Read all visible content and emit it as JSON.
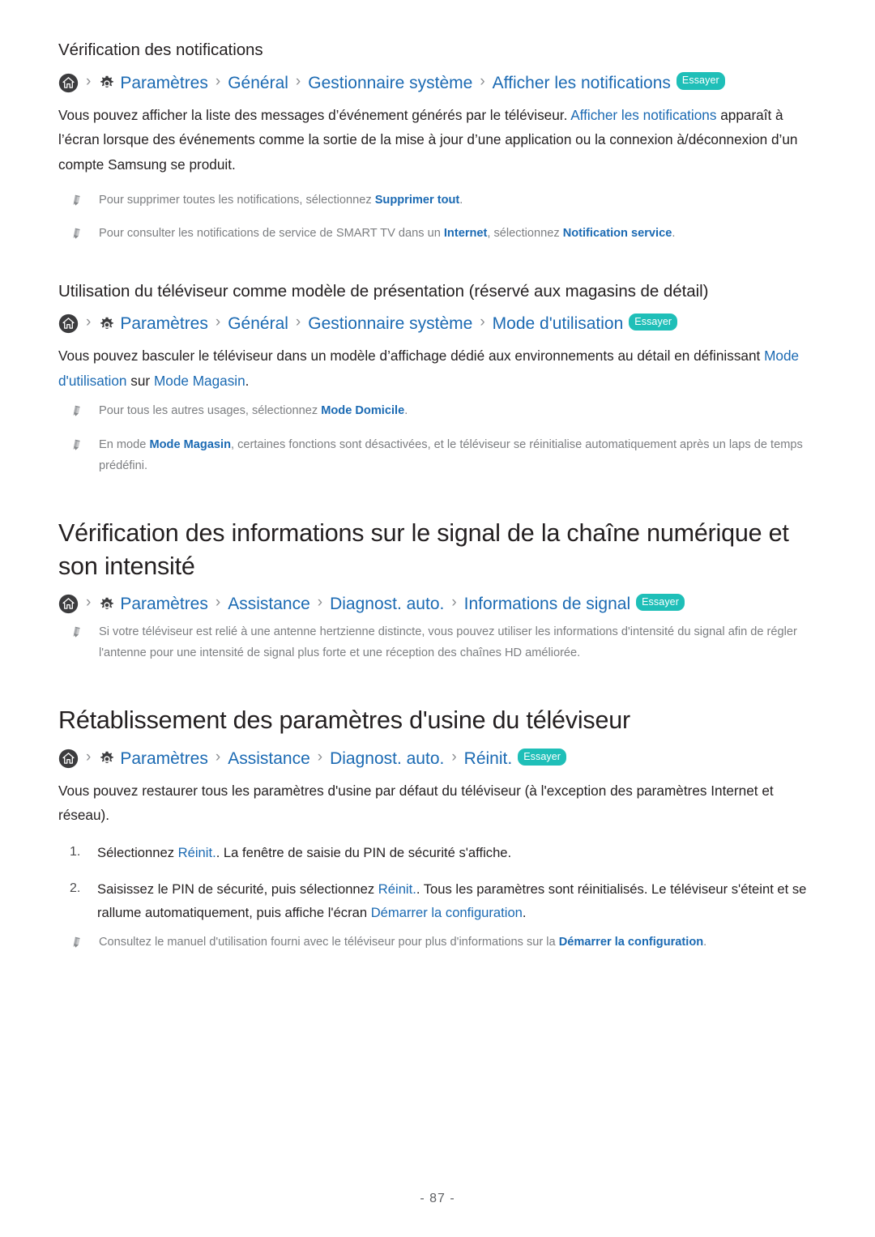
{
  "document": {
    "page_number": "- 87 -"
  },
  "sections": [
    {
      "heading": "Vérification des notifications",
      "breadcrumb": {
        "home_icon": "home-icon",
        "gear_icon": "gear-icon",
        "segments": [
          "Paramètres",
          "Général",
          "Gestionnaire système",
          "Afficher les notifications"
        ],
        "separator": "›",
        "badge": "Essayer"
      },
      "paragraph": {
        "part1": "Vous pouvez afficher la liste des messages d’événement générés par le téléviseur. ",
        "link1": "Afficher les notifications",
        "part2": " apparaît à l’écran lorsque des événements comme la sortie de la mise à jour d’une application ou la connexion à/déconnexion d’un compte Samsung se produit."
      },
      "notes": [
        {
          "icon": "pencil-icon",
          "part1": "Pour supprimer toutes les notifications, sélectionnez ",
          "link1": "Supprimer tout",
          "part2": "."
        },
        {
          "icon": "pencil-icon",
          "part1": "Pour consulter les notifications de service de SMART TV dans un ",
          "link1": "Internet",
          "part2": ", sélectionnez ",
          "link2": "Notification service",
          "part3": "."
        }
      ]
    },
    {
      "heading": "Utilisation du téléviseur comme modèle de présentation (réservé aux magasins de détail)",
      "breadcrumb": {
        "home_icon": "home-icon",
        "gear_icon": "gear-icon",
        "segments": [
          "Paramètres",
          "Général",
          "Gestionnaire système",
          "Mode d'utilisation"
        ],
        "separator": "›",
        "badge": "Essayer"
      },
      "paragraph": {
        "part1": "Vous pouvez basculer le téléviseur dans un modèle d’affichage dédié aux environnements au détail en définissant ",
        "link1": "Mode d'utilisation",
        "part2": " sur ",
        "link2": "Mode Magasin",
        "part3": "."
      },
      "notes": [
        {
          "icon": "pencil-icon",
          "part1": "Pour tous les autres usages, sélectionnez ",
          "link1": "Mode Domicile",
          "part2": "."
        },
        {
          "icon": "pencil-icon",
          "part1": "En mode ",
          "link1": "Mode Magasin",
          "part2": ", certaines fonctions sont désactivées, et le téléviseur se réinitialise automatiquement après un laps de temps prédéfini."
        }
      ]
    }
  ],
  "chapters": [
    {
      "heading": "Vérification des informations sur le signal de la chaîne numérique et son intensité",
      "breadcrumb": {
        "home_icon": "home-icon",
        "gear_icon": "gear-icon",
        "segments": [
          "Paramètres",
          "Assistance",
          "Diagnost. auto.",
          "Informations de signal"
        ],
        "separator": "›",
        "badge": "Essayer"
      },
      "notes": [
        {
          "icon": "pencil-icon",
          "text": "Si votre téléviseur est relié à une antenne hertzienne distincte, vous pouvez utiliser les informations d'intensité du signal afin de régler l'antenne pour une intensité de signal plus forte et une réception des chaînes HD améliorée."
        }
      ]
    },
    {
      "heading": "Rétablissement des paramètres d'usine du téléviseur",
      "breadcrumb": {
        "home_icon": "home-icon",
        "gear_icon": "gear-icon",
        "segments": [
          "Paramètres",
          "Assistance",
          "Diagnost. auto.",
          "Réinit."
        ],
        "separator": "›",
        "badge": "Essayer"
      },
      "paragraph": {
        "part1": "Vous pouvez restaurer tous les paramètres d'usine par défaut du téléviseur (à l'exception des paramètres Internet et réseau)."
      },
      "steps": [
        {
          "num": "1.",
          "part1": "Sélectionnez ",
          "link1": "Réinit.",
          "part2": ". La fenêtre de saisie du PIN de sécurité s'affiche."
        },
        {
          "num": "2.",
          "part1": "Saisissez le PIN de sécurité, puis sélectionnez ",
          "link1": "Réinit.",
          "part2": ". Tous les paramètres sont réinitialisés. Le téléviseur s'éteint et se rallume automatiquement, puis affiche l'écran ",
          "link2": "Démarrer la configuration",
          "part3": "."
        }
      ],
      "notes": [
        {
          "icon": "pencil-icon",
          "part1": "Consultez le manuel d'utilisation fourni avec le téléviseur pour plus d'informations sur la ",
          "link1": "Démarrer la configuration",
          "part2": "."
        }
      ]
    }
  ],
  "colors": {
    "link_blue": "#1b6ab3",
    "badge_teal": "#1fbfb8",
    "note_gray": "#7c7e81",
    "text_black": "#231f20"
  }
}
